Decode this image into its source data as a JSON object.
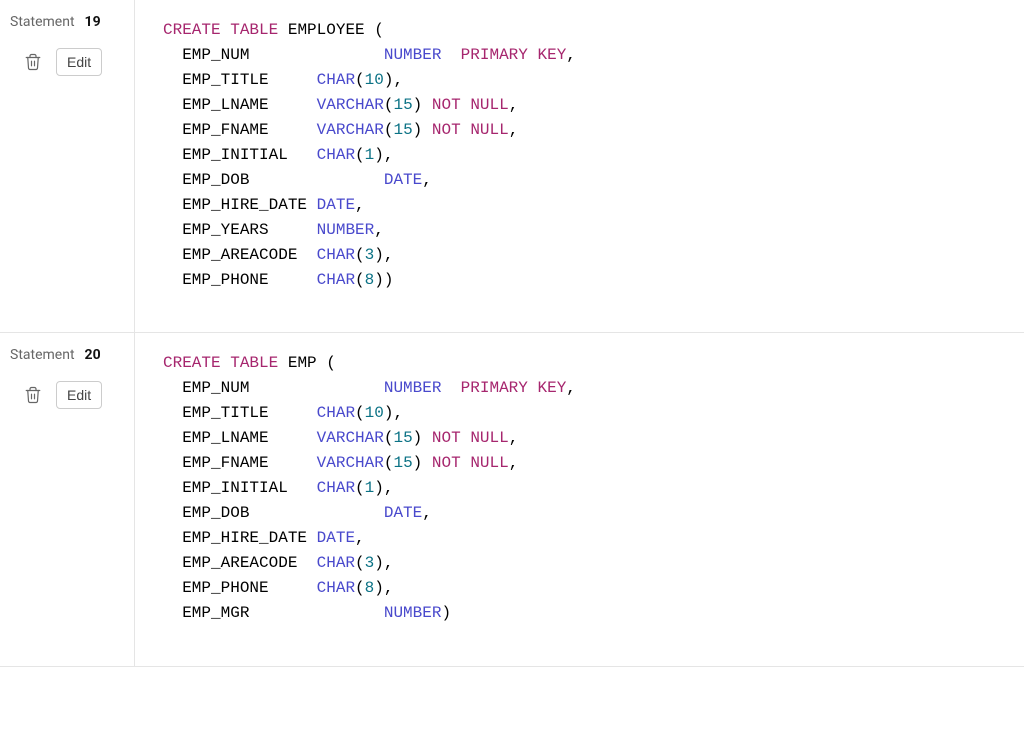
{
  "statements": [
    {
      "label": "Statement",
      "number": "19",
      "edit_label": "Edit",
      "code_tokens": [
        {
          "t": "kw",
          "v": "CREATE"
        },
        {
          "t": "sp"
        },
        {
          "t": "kw",
          "v": "TABLE"
        },
        {
          "t": "sp"
        },
        {
          "t": "id",
          "v": "EMPLOYEE"
        },
        {
          "t": "sp"
        },
        {
          "t": "p",
          "v": "("
        },
        {
          "t": "nl"
        },
        {
          "t": "in"
        },
        {
          "t": "id",
          "v": "EMP_NUM"
        },
        {
          "t": "pad",
          "v": 14
        },
        {
          "t": "type",
          "v": "NUMBER"
        },
        {
          "t": "pad",
          "v": 2
        },
        {
          "t": "kw",
          "v": "PRIMARY"
        },
        {
          "t": "sp"
        },
        {
          "t": "kw",
          "v": "KEY"
        },
        {
          "t": "p",
          "v": ","
        },
        {
          "t": "nl"
        },
        {
          "t": "in"
        },
        {
          "t": "id",
          "v": "EMP_TITLE"
        },
        {
          "t": "pad",
          "v": 5
        },
        {
          "t": "type",
          "v": "CHAR"
        },
        {
          "t": "p",
          "v": "("
        },
        {
          "t": "num",
          "v": "10"
        },
        {
          "t": "p",
          "v": ")"
        },
        {
          "t": "p",
          "v": ","
        },
        {
          "t": "nl"
        },
        {
          "t": "in"
        },
        {
          "t": "id",
          "v": "EMP_LNAME"
        },
        {
          "t": "pad",
          "v": 5
        },
        {
          "t": "type",
          "v": "VARCHAR"
        },
        {
          "t": "p",
          "v": "("
        },
        {
          "t": "num",
          "v": "15"
        },
        {
          "t": "p",
          "v": ")"
        },
        {
          "t": "sp"
        },
        {
          "t": "kw",
          "v": "NOT"
        },
        {
          "t": "sp"
        },
        {
          "t": "kw",
          "v": "NULL"
        },
        {
          "t": "p",
          "v": ","
        },
        {
          "t": "nl"
        },
        {
          "t": "in"
        },
        {
          "t": "id",
          "v": "EMP_FNAME"
        },
        {
          "t": "pad",
          "v": 5
        },
        {
          "t": "type",
          "v": "VARCHAR"
        },
        {
          "t": "p",
          "v": "("
        },
        {
          "t": "num",
          "v": "15"
        },
        {
          "t": "p",
          "v": ")"
        },
        {
          "t": "sp"
        },
        {
          "t": "kw",
          "v": "NOT"
        },
        {
          "t": "sp"
        },
        {
          "t": "kw",
          "v": "NULL"
        },
        {
          "t": "p",
          "v": ","
        },
        {
          "t": "nl"
        },
        {
          "t": "in"
        },
        {
          "t": "id",
          "v": "EMP_INITIAL"
        },
        {
          "t": "pad",
          "v": 3
        },
        {
          "t": "type",
          "v": "CHAR"
        },
        {
          "t": "p",
          "v": "("
        },
        {
          "t": "num",
          "v": "1"
        },
        {
          "t": "p",
          "v": ")"
        },
        {
          "t": "p",
          "v": ","
        },
        {
          "t": "nl"
        },
        {
          "t": "in"
        },
        {
          "t": "id",
          "v": "EMP_DOB"
        },
        {
          "t": "pad",
          "v": 14
        },
        {
          "t": "type",
          "v": "DATE"
        },
        {
          "t": "p",
          "v": ","
        },
        {
          "t": "nl"
        },
        {
          "t": "in"
        },
        {
          "t": "id",
          "v": "EMP_HIRE_DATE"
        },
        {
          "t": "sp"
        },
        {
          "t": "type",
          "v": "DATE"
        },
        {
          "t": "p",
          "v": ","
        },
        {
          "t": "nl"
        },
        {
          "t": "in"
        },
        {
          "t": "id",
          "v": "EMP_YEARS"
        },
        {
          "t": "pad",
          "v": 5
        },
        {
          "t": "type",
          "v": "NUMBER"
        },
        {
          "t": "p",
          "v": ","
        },
        {
          "t": "nl"
        },
        {
          "t": "in"
        },
        {
          "t": "id",
          "v": "EMP_AREACODE"
        },
        {
          "t": "pad",
          "v": 2
        },
        {
          "t": "type",
          "v": "CHAR"
        },
        {
          "t": "p",
          "v": "("
        },
        {
          "t": "num",
          "v": "3"
        },
        {
          "t": "p",
          "v": ")"
        },
        {
          "t": "p",
          "v": ","
        },
        {
          "t": "nl"
        },
        {
          "t": "in"
        },
        {
          "t": "id",
          "v": "EMP_PHONE"
        },
        {
          "t": "pad",
          "v": 5
        },
        {
          "t": "type",
          "v": "CHAR"
        },
        {
          "t": "p",
          "v": "("
        },
        {
          "t": "num",
          "v": "8"
        },
        {
          "t": "p",
          "v": ")"
        },
        {
          "t": "p",
          "v": ")"
        }
      ]
    },
    {
      "label": "Statement",
      "number": "20",
      "edit_label": "Edit",
      "code_tokens": [
        {
          "t": "kw",
          "v": "CREATE"
        },
        {
          "t": "sp"
        },
        {
          "t": "kw",
          "v": "TABLE"
        },
        {
          "t": "sp"
        },
        {
          "t": "id",
          "v": "EMP"
        },
        {
          "t": "sp"
        },
        {
          "t": "p",
          "v": "("
        },
        {
          "t": "nl"
        },
        {
          "t": "in"
        },
        {
          "t": "id",
          "v": "EMP_NUM"
        },
        {
          "t": "pad",
          "v": 14
        },
        {
          "t": "type",
          "v": "NUMBER"
        },
        {
          "t": "pad",
          "v": 2
        },
        {
          "t": "kw",
          "v": "PRIMARY"
        },
        {
          "t": "sp"
        },
        {
          "t": "kw",
          "v": "KEY"
        },
        {
          "t": "p",
          "v": ","
        },
        {
          "t": "nl"
        },
        {
          "t": "in"
        },
        {
          "t": "id",
          "v": "EMP_TITLE"
        },
        {
          "t": "pad",
          "v": 5
        },
        {
          "t": "type",
          "v": "CHAR"
        },
        {
          "t": "p",
          "v": "("
        },
        {
          "t": "num",
          "v": "10"
        },
        {
          "t": "p",
          "v": ")"
        },
        {
          "t": "p",
          "v": ","
        },
        {
          "t": "nl"
        },
        {
          "t": "in"
        },
        {
          "t": "id",
          "v": "EMP_LNAME"
        },
        {
          "t": "pad",
          "v": 5
        },
        {
          "t": "type",
          "v": "VARCHAR"
        },
        {
          "t": "p",
          "v": "("
        },
        {
          "t": "num",
          "v": "15"
        },
        {
          "t": "p",
          "v": ")"
        },
        {
          "t": "sp"
        },
        {
          "t": "kw",
          "v": "NOT"
        },
        {
          "t": "sp"
        },
        {
          "t": "kw",
          "v": "NULL"
        },
        {
          "t": "p",
          "v": ","
        },
        {
          "t": "nl"
        },
        {
          "t": "in"
        },
        {
          "t": "id",
          "v": "EMP_FNAME"
        },
        {
          "t": "pad",
          "v": 5
        },
        {
          "t": "type",
          "v": "VARCHAR"
        },
        {
          "t": "p",
          "v": "("
        },
        {
          "t": "num",
          "v": "15"
        },
        {
          "t": "p",
          "v": ")"
        },
        {
          "t": "sp"
        },
        {
          "t": "kw",
          "v": "NOT"
        },
        {
          "t": "sp"
        },
        {
          "t": "kw",
          "v": "NULL"
        },
        {
          "t": "p",
          "v": ","
        },
        {
          "t": "nl"
        },
        {
          "t": "in"
        },
        {
          "t": "id",
          "v": "EMP_INITIAL"
        },
        {
          "t": "pad",
          "v": 3
        },
        {
          "t": "type",
          "v": "CHAR"
        },
        {
          "t": "p",
          "v": "("
        },
        {
          "t": "num",
          "v": "1"
        },
        {
          "t": "p",
          "v": ")"
        },
        {
          "t": "p",
          "v": ","
        },
        {
          "t": "nl"
        },
        {
          "t": "in"
        },
        {
          "t": "id",
          "v": "EMP_DOB"
        },
        {
          "t": "pad",
          "v": 14
        },
        {
          "t": "type",
          "v": "DATE"
        },
        {
          "t": "p",
          "v": ","
        },
        {
          "t": "nl"
        },
        {
          "t": "in"
        },
        {
          "t": "id",
          "v": "EMP_HIRE_DATE"
        },
        {
          "t": "sp"
        },
        {
          "t": "type",
          "v": "DATE"
        },
        {
          "t": "p",
          "v": ","
        },
        {
          "t": "nl"
        },
        {
          "t": "in"
        },
        {
          "t": "id",
          "v": "EMP_AREACODE"
        },
        {
          "t": "pad",
          "v": 2
        },
        {
          "t": "type",
          "v": "CHAR"
        },
        {
          "t": "p",
          "v": "("
        },
        {
          "t": "num",
          "v": "3"
        },
        {
          "t": "p",
          "v": ")"
        },
        {
          "t": "p",
          "v": ","
        },
        {
          "t": "nl"
        },
        {
          "t": "in"
        },
        {
          "t": "id",
          "v": "EMP_PHONE"
        },
        {
          "t": "pad",
          "v": 5
        },
        {
          "t": "type",
          "v": "CHAR"
        },
        {
          "t": "p",
          "v": "("
        },
        {
          "t": "num",
          "v": "8"
        },
        {
          "t": "p",
          "v": ")"
        },
        {
          "t": "p",
          "v": ","
        },
        {
          "t": "nl"
        },
        {
          "t": "in"
        },
        {
          "t": "id",
          "v": "EMP_MGR"
        },
        {
          "t": "pad",
          "v": 14
        },
        {
          "t": "type",
          "v": "NUMBER"
        },
        {
          "t": "p",
          "v": ")"
        }
      ]
    }
  ]
}
